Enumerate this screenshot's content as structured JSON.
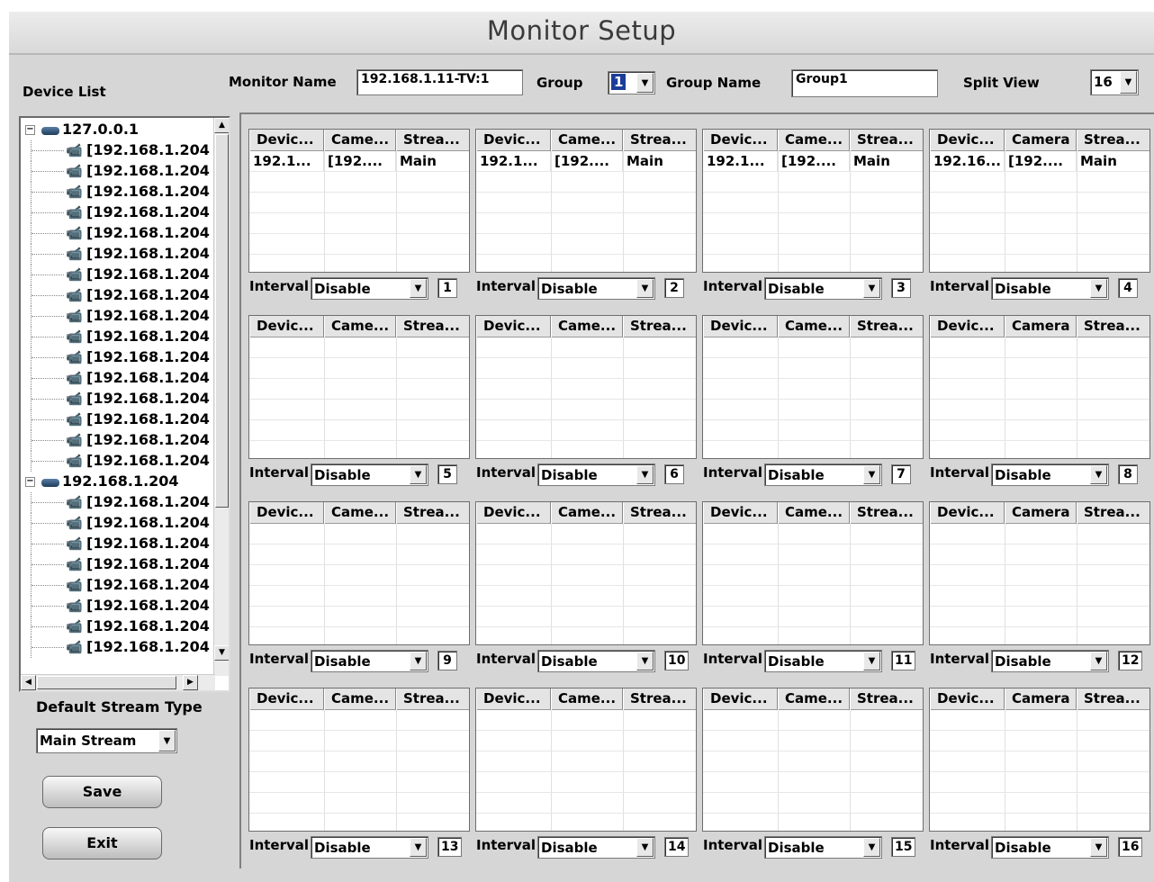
{
  "title": "Monitor Setup",
  "device_list": {
    "label": "Device List",
    "servers": [
      {
        "name": "127.0.0.1",
        "cameras": [
          "[192.168.1.204",
          "[192.168.1.204",
          "[192.168.1.204",
          "[192.168.1.204",
          "[192.168.1.204",
          "[192.168.1.204",
          "[192.168.1.204",
          "[192.168.1.204",
          "[192.168.1.204",
          "[192.168.1.204",
          "[192.168.1.204",
          "[192.168.1.204",
          "[192.168.1.204",
          "[192.168.1.204",
          "[192.168.1.204",
          "[192.168.1.204"
        ]
      },
      {
        "name": "192.168.1.204",
        "cameras": [
          "[192.168.1.204",
          "[192.168.1.204",
          "[192.168.1.204",
          "[192.168.1.204",
          "[192.168.1.204",
          "[192.168.1.204",
          "[192.168.1.204",
          "[192.168.1.204"
        ]
      }
    ]
  },
  "toolbar": {
    "monitor_name_label": "Monitor Name",
    "monitor_name_value": "192.168.1.11-TV:1",
    "group_label": "Group",
    "group_value": "1",
    "group_name_label": "Group Name",
    "group_name_value": "Group1",
    "split_view_label": "Split View",
    "split_view_value": "16"
  },
  "default_stream": {
    "label": "Default Stream Type",
    "value": "Main Stream"
  },
  "buttons": {
    "save": "Save",
    "exit": "Exit"
  },
  "panels": [
    {
      "num": "1",
      "headers": [
        "Devic...",
        "Came...",
        "Strea..."
      ],
      "rows": [
        [
          "192.1...",
          "[192....",
          "Main"
        ]
      ],
      "interval_label": "Interval",
      "interval_value": "Disable"
    },
    {
      "num": "2",
      "headers": [
        "Devic...",
        "Came...",
        "Strea..."
      ],
      "rows": [
        [
          "192.1...",
          "[192....",
          "Main"
        ]
      ],
      "interval_label": "Interval",
      "interval_value": "Disable"
    },
    {
      "num": "3",
      "headers": [
        "Devic...",
        "Came...",
        "Strea..."
      ],
      "rows": [
        [
          "192.1...",
          "[192....",
          "Main"
        ]
      ],
      "interval_label": "Interval",
      "interval_value": "Disable"
    },
    {
      "num": "4",
      "headers": [
        "Devic...",
        "Camera",
        "Strea..."
      ],
      "rows": [
        [
          "192.16...",
          "[192....",
          "Main"
        ]
      ],
      "interval_label": "Interval",
      "interval_value": "Disable"
    },
    {
      "num": "5",
      "headers": [
        "Devic...",
        "Came...",
        "Strea..."
      ],
      "rows": [],
      "interval_label": "Interval",
      "interval_value": "Disable"
    },
    {
      "num": "6",
      "headers": [
        "Devic...",
        "Came...",
        "Strea..."
      ],
      "rows": [],
      "interval_label": "Interval",
      "interval_value": "Disable"
    },
    {
      "num": "7",
      "headers": [
        "Devic...",
        "Came...",
        "Strea..."
      ],
      "rows": [],
      "interval_label": "Interval",
      "interval_value": "Disable"
    },
    {
      "num": "8",
      "headers": [
        "Devic...",
        "Camera",
        "Strea..."
      ],
      "rows": [],
      "interval_label": "Interval",
      "interval_value": "Disable"
    },
    {
      "num": "9",
      "headers": [
        "Devic...",
        "Came...",
        "Strea..."
      ],
      "rows": [],
      "interval_label": "Interval",
      "interval_value": "Disable"
    },
    {
      "num": "10",
      "headers": [
        "Devic...",
        "Came...",
        "Strea..."
      ],
      "rows": [],
      "interval_label": "Interval",
      "interval_value": "Disable"
    },
    {
      "num": "11",
      "headers": [
        "Devic...",
        "Came...",
        "Strea..."
      ],
      "rows": [],
      "interval_label": "Interval",
      "interval_value": "Disable"
    },
    {
      "num": "12",
      "headers": [
        "Devic...",
        "Camera",
        "Strea..."
      ],
      "rows": [],
      "interval_label": "Interval",
      "interval_value": "Disable"
    },
    {
      "num": "13",
      "headers": [
        "Devic...",
        "Came...",
        "Strea..."
      ],
      "rows": [],
      "interval_label": "Interval",
      "interval_value": "Disable"
    },
    {
      "num": "14",
      "headers": [
        "Devic...",
        "Came...",
        "Strea..."
      ],
      "rows": [],
      "interval_label": "Interval",
      "interval_value": "Disable"
    },
    {
      "num": "15",
      "headers": [
        "Devic...",
        "Came...",
        "Strea..."
      ],
      "rows": [],
      "interval_label": "Interval",
      "interval_value": "Disable"
    },
    {
      "num": "16",
      "headers": [
        "Devic...",
        "Camera",
        "Strea..."
      ],
      "rows": [],
      "interval_label": "Interval",
      "interval_value": "Disable"
    }
  ],
  "icons": {
    "server": "server-icon",
    "camera": "camera-icon",
    "dropdown": "chevron-down-icon"
  }
}
